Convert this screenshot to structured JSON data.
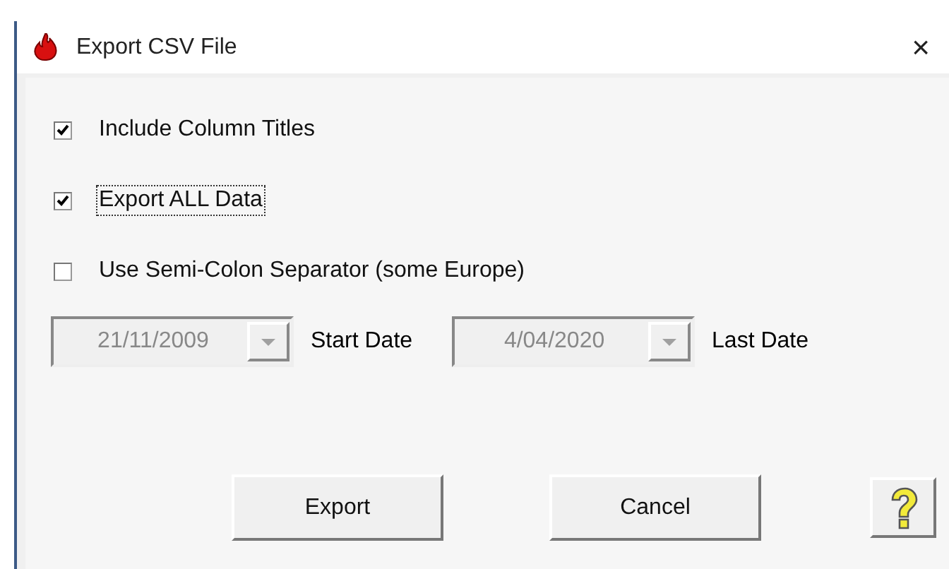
{
  "window": {
    "title": "Export CSV File",
    "close": "×"
  },
  "options": [
    {
      "label": "Include Column Titles",
      "checked": true,
      "focused": false
    },
    {
      "label": "Export ALL Data",
      "checked": true,
      "focused": true
    },
    {
      "label": "Use Semi-Colon Separator (some Europe)",
      "checked": false,
      "focused": false
    }
  ],
  "dates": [
    {
      "date": "21/11/2009",
      "caption": "Start Date",
      "disabled": true
    },
    {
      "date": "4/04/2020",
      "caption": "Last Date",
      "disabled": true
    }
  ],
  "buttons": [
    "Export",
    "Cancel"
  ],
  "help_button": true
}
